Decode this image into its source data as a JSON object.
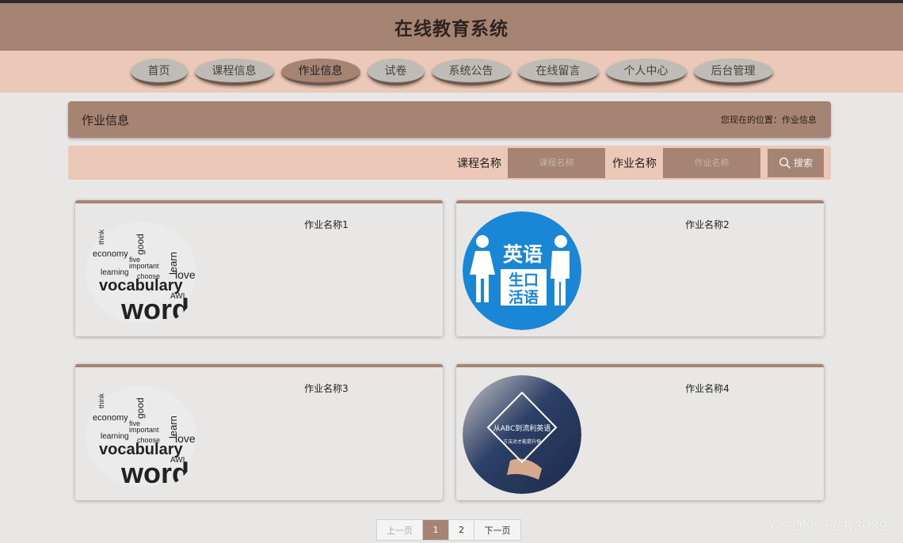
{
  "site": {
    "title": "在线教育系统"
  },
  "nav": {
    "items": [
      {
        "label": "首页"
      },
      {
        "label": "课程信息"
      },
      {
        "label": "作业信息"
      },
      {
        "label": "试卷"
      },
      {
        "label": "系统公告"
      },
      {
        "label": "在线留言"
      },
      {
        "label": "个人中心"
      },
      {
        "label": "后台管理"
      }
    ],
    "active": "作业信息"
  },
  "location": {
    "title": "作业信息",
    "path": "您现在的位置：作业信息"
  },
  "search": {
    "course_label": "课程名称",
    "course_placeholder": "课程名称",
    "homework_label": "作业名称",
    "homework_placeholder": "作业名称",
    "button_label": "搜索"
  },
  "cards": [
    {
      "title": "作业名称1",
      "image": "word-cloud"
    },
    {
      "title": "作业名称2",
      "image": "english-oral-badge",
      "badge_lines": [
        "英语",
        "生口",
        "活语"
      ]
    },
    {
      "title": "作业名称3",
      "image": "word-cloud"
    },
    {
      "title": "作业名称4",
      "image": "classroom-photo",
      "overlay_lines": [
        "从ABC到流利英语",
        "方法对才能提升快"
      ]
    }
  ],
  "wordcloud": [
    "economy",
    "think",
    "learn",
    "vocabulary",
    "words",
    "love",
    "choose",
    "AWL",
    "important",
    "learning",
    "good",
    "five"
  ],
  "pagination": {
    "prev": "上一页",
    "pages": [
      "1",
      "2"
    ],
    "current": "1",
    "next": "下一页"
  },
  "watermark": "CSDN @CK3039",
  "colors": {
    "brand": "#a68473",
    "nav_bg": "#ecc8b8",
    "page_bg": "#e8e7e5"
  }
}
